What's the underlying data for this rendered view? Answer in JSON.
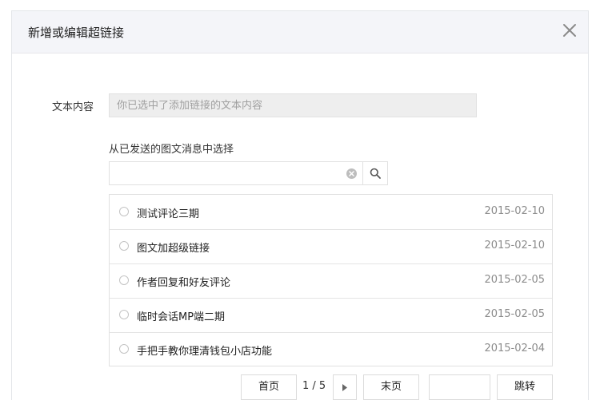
{
  "dialog": {
    "title": "新增或编辑超链接",
    "close_icon": "close-icon"
  },
  "form": {
    "text_label": "文本内容",
    "text_placeholder": "你已选中了添加链接的文本内容",
    "choose_label": "从已发送的图文消息中选择",
    "search_value": "",
    "search_icon": "search-icon",
    "clear_icon": "clear-icon"
  },
  "articles": [
    {
      "title": "测试评论三期",
      "date": "2015-02-10"
    },
    {
      "title": "图文加超级链接",
      "date": "2015-02-10"
    },
    {
      "title": "作者回复和好友评论",
      "date": "2015-02-05"
    },
    {
      "title": "临时会话MP端二期",
      "date": "2015-02-05"
    },
    {
      "title": "手把手教你理清钱包小店功能",
      "date": "2015-02-04"
    }
  ],
  "pager": {
    "first_label": "首页",
    "page_indicator": "1 / 5",
    "next_icon": "next-arrow-icon",
    "last_label": "末页",
    "page_input_value": "",
    "jump_label": "跳转"
  },
  "colors": {
    "header_bg": "#f4f5f9",
    "border": "#e1e1e1",
    "date_text": "#8c8c8c"
  }
}
